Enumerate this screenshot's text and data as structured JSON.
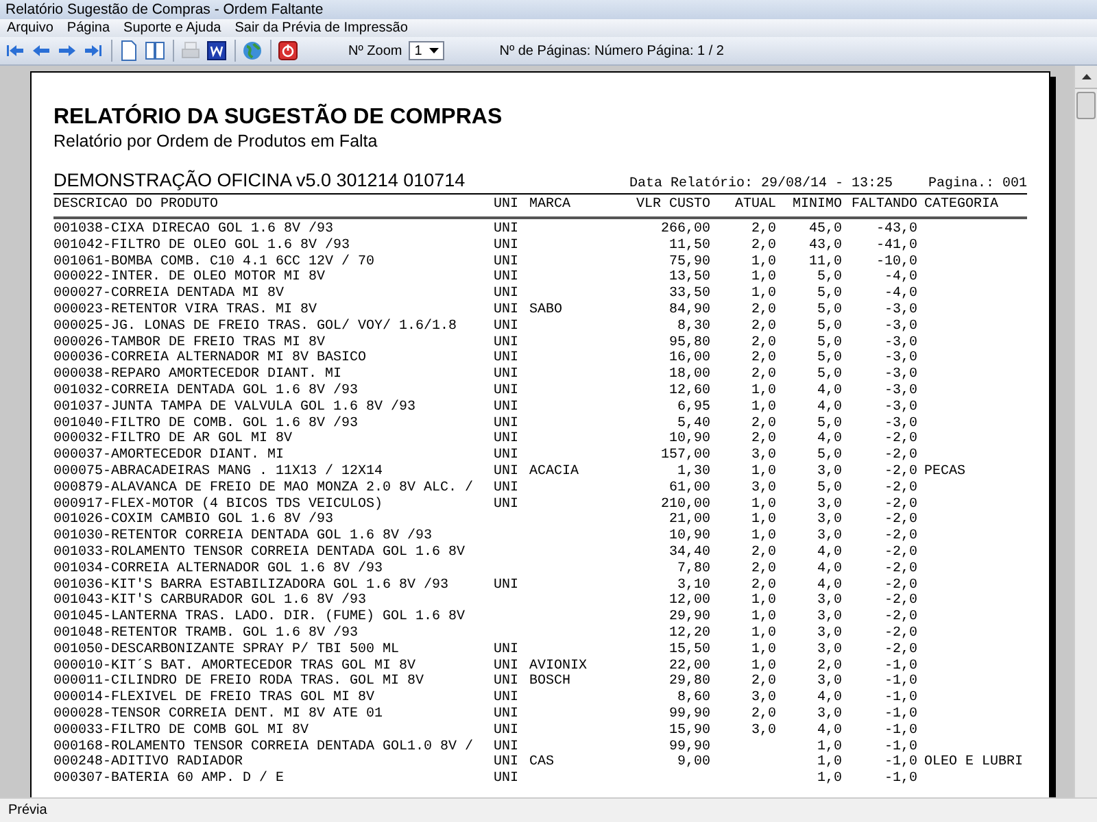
{
  "window": {
    "title": "Relatório Sugestão de Compras - Ordem Faltante"
  },
  "menu": [
    "Arquivo",
    "Página",
    "Suporte e Ajuda",
    "Sair da Prévia de Impressão"
  ],
  "toolbar": {
    "buttons": [
      {
        "kind": "first",
        "disabled": false
      },
      {
        "kind": "prev",
        "disabled": false
      },
      {
        "kind": "next",
        "disabled": false
      },
      {
        "kind": "last",
        "disabled": false
      },
      {
        "kind": "sep"
      },
      {
        "kind": "page",
        "disabled": false
      },
      {
        "kind": "twopage",
        "disabled": false
      },
      {
        "kind": "sep"
      },
      {
        "kind": "print",
        "disabled": true
      },
      {
        "kind": "word",
        "disabled": false
      },
      {
        "kind": "sep"
      },
      {
        "kind": "export",
        "disabled": false
      },
      {
        "kind": "sep"
      },
      {
        "kind": "exit",
        "disabled": false
      }
    ],
    "zoom_label": "Nº Zoom",
    "zoom_value": "1",
    "pages_text": "Nº de Páginas: Número Página: 1 / 2"
  },
  "report": {
    "title": "RELATÓRIO DA SUGESTÃO DE COMPRAS",
    "subtitle": "Relatório por Ordem de Produtos em Falta",
    "company": "DEMONSTRAÇÃO OFICINA v5.0 301214 010714",
    "date": "Data Relatório: 29/08/14 - 13:25",
    "page": "Pagina.: 001",
    "columns": [
      "DESCRICAO DO PRODUTO",
      "UNI",
      "MARCA",
      "VLR CUSTO",
      "ATUAL",
      "MINIMO",
      "FALTANDO",
      "CATEGORIA"
    ],
    "rows": [
      [
        "001038-CIXA DIRECAO GOL 1.6 8V /93",
        "UNI",
        "",
        "266,00",
        "2,0",
        "45,0",
        "-43,0",
        ""
      ],
      [
        "001042-FILTRO DE OLEO GOL 1.6 8V /93",
        "UNI",
        "",
        "11,50",
        "2,0",
        "43,0",
        "-41,0",
        ""
      ],
      [
        "001061-BOMBA COMB. C10 4.1 6CC 12V / 70",
        "UNI",
        "",
        "75,90",
        "1,0",
        "11,0",
        "-10,0",
        ""
      ],
      [
        "000022-INTER. DE OLEO MOTOR  MI 8V",
        "UNI",
        "",
        "13,50",
        "1,0",
        "5,0",
        "-4,0",
        ""
      ],
      [
        "000027-CORREIA DENTADA MI 8V",
        "UNI",
        "",
        "33,50",
        "1,0",
        "5,0",
        "-4,0",
        ""
      ],
      [
        "000023-RETENTOR VIRA TRAS. MI 8V",
        "UNI",
        "SABO",
        "84,90",
        "2,0",
        "5,0",
        "-3,0",
        ""
      ],
      [
        "000025-JG. LONAS DE FREIO  TRAS.  GOL/ VOY/ 1.6/1.8",
        "UNI",
        "",
        "8,30",
        "2,0",
        "5,0",
        "-3,0",
        ""
      ],
      [
        "000026-TAMBOR DE FREIO TRAS MI 8V",
        "UNI",
        "",
        "95,80",
        "2,0",
        "5,0",
        "-3,0",
        ""
      ],
      [
        "000036-CORREIA ALTERNADOR MI 8V BASICO",
        "UNI",
        "",
        "16,00",
        "2,0",
        "5,0",
        "-3,0",
        ""
      ],
      [
        "000038-REPARO AMORTECEDOR DIANT. MI",
        "UNI",
        "",
        "18,00",
        "2,0",
        "5,0",
        "-3,0",
        ""
      ],
      [
        "001032-CORREIA DENTADA GOL 1.6 8V /93",
        "UNI",
        "",
        "12,60",
        "1,0",
        "4,0",
        "-3,0",
        ""
      ],
      [
        "001037-JUNTA TAMPA DE VALVULA GOL 1.6 8V /93",
        "UNI",
        "",
        "6,95",
        "1,0",
        "4,0",
        "-3,0",
        ""
      ],
      [
        "001040-FILTRO DE COMB. GOL 1.6 8V /93",
        "UNI",
        "",
        "5,40",
        "2,0",
        "5,0",
        "-3,0",
        ""
      ],
      [
        "000032-FILTRO DE AR GOL MI 8V",
        "UNI",
        "",
        "10,90",
        "2,0",
        "4,0",
        "-2,0",
        ""
      ],
      [
        "000037-AMORTECEDOR DIANT. MI",
        "UNI",
        "",
        "157,00",
        "3,0",
        "5,0",
        "-2,0",
        ""
      ],
      [
        "000075-ABRACADEIRAS MANG . 11X13 / 12X14",
        "UNI",
        "ACACIA",
        "1,30",
        "1,0",
        "3,0",
        "-2,0",
        "PECAS"
      ],
      [
        "000879-ALAVANCA DE FREIO DE MAO MONZA 2.0 8V ALC. /",
        "UNI",
        "",
        "61,00",
        "3,0",
        "5,0",
        "-2,0",
        ""
      ],
      [
        "000917-FLEX-MOTOR (4 BICOS TDS VEICULOS)",
        "UNI",
        "",
        "210,00",
        "1,0",
        "3,0",
        "-2,0",
        ""
      ],
      [
        "001026-COXIM CAMBIO GOL 1.6 8V /93",
        "",
        "",
        "21,00",
        "1,0",
        "3,0",
        "-2,0",
        ""
      ],
      [
        "001030-RETENTOR CORREIA DENTADA GOL 1.6 8V /93",
        "",
        "",
        "10,90",
        "1,0",
        "3,0",
        "-2,0",
        ""
      ],
      [
        "001033-ROLAMENTO TENSOR CORREIA DENTADA GOL 1.6 8V",
        "",
        "",
        "34,40",
        "2,0",
        "4,0",
        "-2,0",
        ""
      ],
      [
        "001034-CORREIA ALTERNADOR GOL 1.6 8V /93",
        "",
        "",
        "7,80",
        "2,0",
        "4,0",
        "-2,0",
        ""
      ],
      [
        "001036-KIT'S BARRA ESTABILIZADORA GOL 1.6 8V /93",
        "UNI",
        "",
        "3,10",
        "2,0",
        "4,0",
        "-2,0",
        ""
      ],
      [
        "001043-KIT'S CARBURADOR GOL 1.6 8V /93",
        "",
        "",
        "12,00",
        "1,0",
        "3,0",
        "-2,0",
        ""
      ],
      [
        "001045-LANTERNA TRAS. LADO. DIR. (FUME) GOL 1.6 8V",
        "",
        "",
        "29,90",
        "1,0",
        "3,0",
        "-2,0",
        ""
      ],
      [
        "001048-RETENTOR TRAMB. GOL 1.6 8V /93",
        "",
        "",
        "12,20",
        "1,0",
        "3,0",
        "-2,0",
        ""
      ],
      [
        "001050-DESCARBONIZANTE SPRAY P/ TBI 500 ML",
        "UNI",
        "",
        "15,50",
        "1,0",
        "3,0",
        "-2,0",
        ""
      ],
      [
        "000010-KIT´S BAT. AMORTECEDOR TRAS GOL MI 8V",
        "UNI",
        "AVIONIX",
        "22,00",
        "1,0",
        "2,0",
        "-1,0",
        ""
      ],
      [
        "000011-CILINDRO DE FREIO RODA TRAS. GOL MI 8V",
        "UNI",
        "BOSCH",
        "29,80",
        "2,0",
        "3,0",
        "-1,0",
        ""
      ],
      [
        "000014-FLEXIVEL DE FREIO TRAS GOL MI 8V",
        "UNI",
        "",
        "8,60",
        "3,0",
        "4,0",
        "-1,0",
        ""
      ],
      [
        "000028-TENSOR CORREIA DENT. MI 8V ATE 01",
        "UNI",
        "",
        "99,90",
        "2,0",
        "3,0",
        "-1,0",
        ""
      ],
      [
        "000033-FILTRO DE  COMB GOL MI 8V",
        "UNI",
        "",
        "15,90",
        "3,0",
        "4,0",
        "-1,0",
        ""
      ],
      [
        "000168-ROLAMENTO TENSOR CORREIA DENTADA GOL1.0 8V /",
        "UNI",
        "",
        "99,90",
        "",
        "1,0",
        "-1,0",
        ""
      ],
      [
        "000248-ADITIVO RADIADOR",
        "UNI",
        "CAS",
        "9,00",
        "",
        "1,0",
        "-1,0",
        "OLEO E LUBRI"
      ],
      [
        "000307-BATERIA 60 AMP. D / E",
        "UNI",
        "",
        "",
        "",
        "1,0",
        "-1,0",
        ""
      ]
    ]
  },
  "status_bar": "Prévia"
}
